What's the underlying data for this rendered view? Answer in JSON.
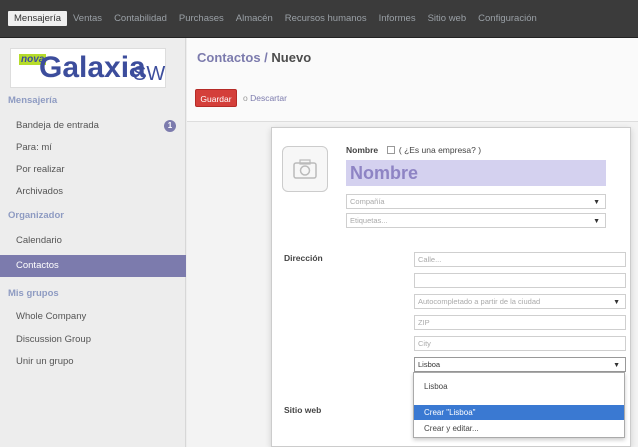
{
  "topbar": {
    "menu": [
      "Mensajería",
      "Ventas",
      "Contabilidad",
      "Purchases",
      "Almacén",
      "Recursos humanos",
      "Informes",
      "Sitio web",
      "Configuración"
    ]
  },
  "logo": {
    "prefix": "nova",
    "name": "Galaxia",
    "suffix": "SW"
  },
  "sidebar": {
    "section1": "Mensajería",
    "items1": [
      "Bandeja de entrada",
      "Para: mí",
      "Por realizar",
      "Archivados"
    ],
    "inbox_badge": "1",
    "section2": "Organizador",
    "items2": [
      "Calendario",
      "Contactos"
    ],
    "section3": "Mis grupos",
    "items3": [
      "Whole Company",
      "Discussion Group",
      "Unir un grupo"
    ]
  },
  "header": {
    "breadcrumb_link": "Contactos",
    "breadcrumb_sep": " / ",
    "breadcrumb_current": "Nuevo",
    "save_label": "Guardar",
    "or_text": "o ",
    "discard_label": "Descartar"
  },
  "form": {
    "name_label": "Nombre",
    "is_company_label": "(  ¿Es una empresa?  )",
    "name_placeholder": "Nombre",
    "company_placeholder": "Compañía",
    "tags_placeholder": "Etiquetas...",
    "address_label": "Dirección",
    "street_placeholder": "Calle...",
    "street2_value": "",
    "autocomplete_placeholder": "Autocompletado a partir de la ciudad",
    "zip_placeholder": "ZIP",
    "city_placeholder": "City",
    "state_value": "Lisboa",
    "website_label": "Sitio web"
  },
  "dropdown": {
    "items": [
      "Lisboa",
      "Crear \"Lisboa\"",
      "Crear y editar..."
    ],
    "selected_index": 1
  }
}
